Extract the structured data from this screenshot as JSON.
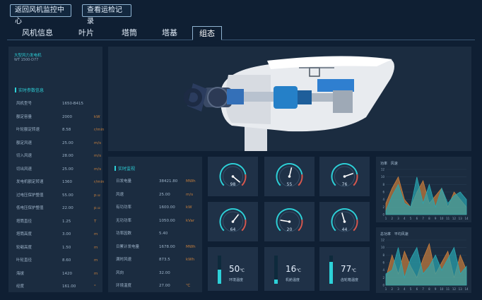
{
  "header": {
    "back_button": "返回风机监控中心",
    "records_button": "查看运检记录"
  },
  "tabs": [
    {
      "label": "风机信息"
    },
    {
      "label": "叶片"
    },
    {
      "label": "塔筒"
    },
    {
      "label": "塔基"
    },
    {
      "label": "组态",
      "active": true
    }
  ],
  "turbine": {
    "name": "大型风力发电机",
    "model": "WT 1500-D77"
  },
  "realtime_info": {
    "title": "实时参数信息",
    "rows": [
      {
        "key": "风机型号",
        "value": "1650-B415",
        "unit": ""
      },
      {
        "key": "额定容量",
        "value": "2000",
        "unit": "kW"
      },
      {
        "key": "叶轮额定转速",
        "value": "8.58",
        "unit": "r/min"
      },
      {
        "key": "额定风速",
        "value": "25.00",
        "unit": "m/s"
      },
      {
        "key": "切入风速",
        "value": "28.00",
        "unit": "m/s"
      },
      {
        "key": "切出风速",
        "value": "25.00",
        "unit": "m/s"
      },
      {
        "key": "发电机额定转速",
        "value": "1360",
        "unit": "r/min"
      },
      {
        "key": "过电压保护整值",
        "value": "55.00",
        "unit": "p.u"
      },
      {
        "key": "低电压保护整值",
        "value": "22.00",
        "unit": "p.u"
      },
      {
        "key": "塔筒直径",
        "value": "1.25",
        "unit": "T"
      },
      {
        "key": "塔筒高度",
        "value": "3.00",
        "unit": "m"
      },
      {
        "key": "轮毂高度",
        "value": "1.50",
        "unit": "m"
      },
      {
        "key": "叶轮直径",
        "value": "8.60",
        "unit": "m"
      },
      {
        "key": "海拔",
        "value": "1420",
        "unit": "m"
      },
      {
        "key": "经度",
        "value": "161.00",
        "unit": "°"
      }
    ]
  },
  "realtime_monitor": {
    "title": "实时监视",
    "rows": [
      {
        "key": "日发电量",
        "value": "38421.80",
        "unit": "MWh"
      },
      {
        "key": "风速",
        "value": "25.00",
        "unit": "m/s"
      },
      {
        "key": "有功功率",
        "value": "1600.00",
        "unit": "kW"
      },
      {
        "key": "无功功率",
        "value": "1050.00",
        "unit": "kVar"
      },
      {
        "key": "功率因数",
        "value": "5.40",
        "unit": ""
      },
      {
        "key": "日累计发电量",
        "value": "1678.00",
        "unit": "MWh"
      },
      {
        "key": "满时风速",
        "value": "873.5",
        "unit": "kWh"
      },
      {
        "key": "风向",
        "value": "32.00",
        "unit": ""
      },
      {
        "key": "环境温度",
        "value": "27.00",
        "unit": "℃"
      }
    ]
  },
  "gauges": [
    {
      "value": "98",
      "level": 0.98
    },
    {
      "value": "55",
      "level": 0.55
    },
    {
      "value": "76",
      "level": 0.76
    },
    {
      "value": "64",
      "level": 0.64
    },
    {
      "value": "20",
      "level": 0.2
    },
    {
      "value": "44",
      "level": 0.44
    }
  ],
  "temps": [
    {
      "value": "50",
      "unit": "℃",
      "label": "环境温度",
      "level": 0.5
    },
    {
      "value": "16",
      "unit": "℃",
      "label": "机舱温度",
      "level": 0.16
    },
    {
      "value": "77",
      "unit": "℃",
      "label": "齿轮箱温度",
      "level": 0.77
    }
  ],
  "chart_data": [
    {
      "type": "area",
      "legend": [
        "功率",
        "风速"
      ],
      "x": [
        1,
        2,
        3,
        4,
        5,
        6,
        7,
        8,
        9,
        10,
        11,
        12,
        13,
        14
      ],
      "xlabels": [
        "1",
        "2",
        "3",
        "4",
        "5",
        "6",
        "7",
        "8",
        "9",
        "10",
        "11",
        "12",
        "13",
        "14"
      ],
      "ylim": [
        0,
        12
      ],
      "yticks": [
        "0",
        "2",
        "4",
        "6",
        "8",
        "10",
        "12"
      ],
      "series": [
        {
          "name": "功率",
          "color": "#c97d3c",
          "values": [
            3,
            7,
            10,
            4,
            2,
            6,
            9,
            3,
            5,
            7,
            2,
            6,
            4,
            2
          ]
        },
        {
          "name": "风速",
          "color": "#2aa7b2",
          "values": [
            1,
            5,
            8,
            3,
            2,
            10,
            3,
            8,
            2,
            7,
            3,
            5,
            6,
            4
          ]
        }
      ]
    },
    {
      "type": "area",
      "legend": [
        "总功率",
        "平均风速"
      ],
      "x": [
        1,
        2,
        3,
        4,
        5,
        6,
        7,
        8,
        9,
        10,
        11,
        12,
        13,
        14
      ],
      "xlabels": [
        "1",
        "2",
        "3",
        "4",
        "5",
        "6",
        "7",
        "8",
        "9",
        "10",
        "11",
        "12",
        "13",
        "14"
      ],
      "ylim": [
        0,
        12
      ],
      "yticks": [
        "0",
        "2",
        "4",
        "6",
        "8",
        "10",
        "12"
      ],
      "series": [
        {
          "name": "总功率",
          "color": "#c97d3c",
          "values": [
            2,
            8,
            3,
            9,
            5,
            2,
            7,
            11,
            3,
            6,
            9,
            2,
            8,
            4
          ]
        },
        {
          "name": "平均风速",
          "color": "#2aa7b2",
          "values": [
            3,
            4,
            10,
            2,
            7,
            10,
            3,
            5,
            8,
            4,
            7,
            10,
            3,
            5
          ]
        }
      ]
    }
  ],
  "colors": {
    "accent": "#2dd1d8",
    "unit": "#c57e3c",
    "panel": "#1b2c40",
    "background": "#0f1f33"
  }
}
